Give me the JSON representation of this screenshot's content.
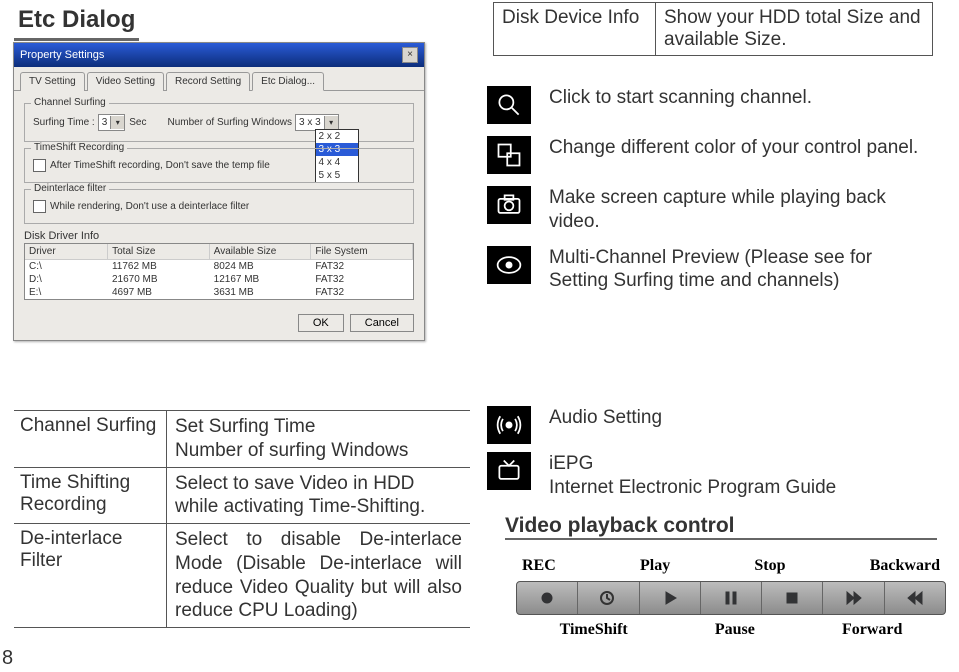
{
  "page": {
    "title": "Etc Dialog",
    "number": "8"
  },
  "dialog": {
    "title": "Property Settings",
    "close": "×",
    "tabs": [
      "TV Setting",
      "Video Setting",
      "Record Setting",
      "Etc Dialog..."
    ],
    "active_tab_index": 3,
    "surfing_legend": "Channel Surfing",
    "surfing_time_label": "Surfing Time :",
    "surfing_time_value": "3",
    "surfing_time_unit": "Sec",
    "num_windows_label": "Number of Surfing Windows",
    "num_windows_value": "3 x 3",
    "num_windows_options": [
      "2 x 2",
      "3 x 3",
      "4 x 4",
      "5 x 5"
    ],
    "timeshift_legend": "TimeShift Recording",
    "timeshift_checkbox": "After TimeShift recording, Don't save the temp file",
    "deint_legend": "Deinterlace filter",
    "deint_checkbox": "While rendering, Don't use a deinterlace filter",
    "disk_info_label": "Disk Driver Info",
    "disk_headers": {
      "driver": "Driver",
      "total": "Total Size",
      "avail": "Available Size",
      "fs": "File System"
    },
    "disk_rows": [
      {
        "driver": "C:\\",
        "total": "11762 MB",
        "avail": "8024 MB",
        "fs": "FAT32"
      },
      {
        "driver": "D:\\",
        "total": "21670 MB",
        "avail": "12167 MB",
        "fs": "FAT32"
      },
      {
        "driver": "E:\\",
        "total": "4697 MB",
        "avail": "3631 MB",
        "fs": "FAT32"
      }
    ],
    "btn_ok": "OK",
    "btn_cancel": "Cancel"
  },
  "mini_table": {
    "left": "Disk Device Info",
    "right": "Show your HDD total Size and available Size."
  },
  "right_items": [
    "Click to start scanning channel.",
    "Change different color of your control panel.",
    "Make screen capture while playing back video.",
    "Multi-Channel Preview (Please see for Setting Surfing time and channels)"
  ],
  "defs": [
    {
      "term": "Channel Surfing",
      "defn": "Set Surfing Time\nNumber of surfing Windows"
    },
    {
      "term": "Time Shifting Recording",
      "defn": "Select to save Video in HDD while activating Time-Shifting."
    },
    {
      "term": "De-interlace Filter",
      "defn": "Select to disable De-interlace Mode (Disable De-interlace will reduce Video Quality but will also reduce CPU Loading)"
    }
  ],
  "rb": {
    "audio": "Audio Setting",
    "iepg1": "iEPG",
    "iepg2": "Internet Electronic Program Guide",
    "video_heading": "Video playback control"
  },
  "playback": {
    "top": [
      "REC",
      "Play",
      "Stop",
      "Backward"
    ],
    "bot": [
      "TimeShift",
      "Pause",
      "Forward"
    ]
  }
}
